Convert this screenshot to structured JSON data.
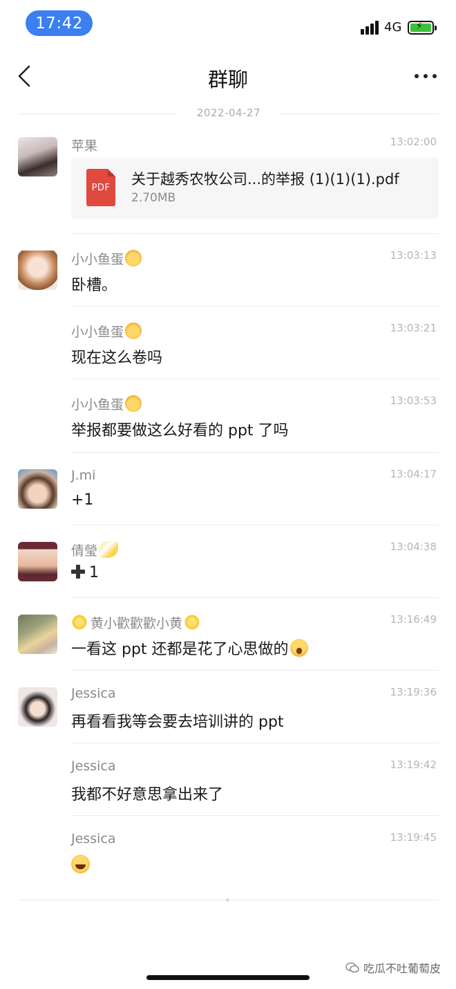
{
  "status_bar": {
    "time": "17:42",
    "network": "4G",
    "battery_charging": true
  },
  "nav": {
    "title": "群聊"
  },
  "date_divider": "2022-04-27",
  "file_message": {
    "sender": "苹果",
    "timestamp": "13:02:00",
    "file_type": "PDF",
    "file_name": "关于越秀农牧公司...的举报 (1)(1)(1).pdf",
    "file_size": "2.70MB"
  },
  "messages": [
    {
      "sender": "小小鱼蛋",
      "sender_emoji": "girl-emoji",
      "timestamp": "13:03:13",
      "text": "卧槽。"
    },
    {
      "sender": "小小鱼蛋",
      "sender_emoji": "girl-emoji",
      "timestamp": "13:03:21",
      "text": "现在这么卷吗"
    },
    {
      "sender": "小小鱼蛋",
      "sender_emoji": "girl-emoji",
      "timestamp": "13:03:53",
      "text": "举报都要做这么好看的 ppt 了吗"
    },
    {
      "sender": "J.mi",
      "timestamp": "13:04:17",
      "text": "+1"
    },
    {
      "sender": "倩瑩",
      "sender_emoji": "comet-emoji",
      "timestamp": "13:04:38",
      "text": "1",
      "prefix_icon": "heavy-plus-icon"
    },
    {
      "sender": "黄小歡歡歡小黄",
      "sender_emoji": "star-emoji",
      "timestamp": "13:16:49",
      "text": "一看这 ppt 还都是花了心思做的",
      "suffix_emoji": "shocked-face-emoji"
    },
    {
      "sender": "Jessica",
      "timestamp": "13:19:36",
      "text": "再看看我等会要去培训讲的 ppt"
    },
    {
      "sender": "Jessica",
      "timestamp": "13:19:42",
      "text": "我都不好意思拿出来了"
    },
    {
      "sender": "Jessica",
      "timestamp": "13:19:45",
      "text": "",
      "suffix_emoji": "tears-of-joy-emoji"
    }
  ],
  "watermark": "吃瓜不吐葡萄皮",
  "colors": {
    "time_pill": "#3b7ff0",
    "pdf_icon": "#e0493e",
    "battery_fill": "#3cc13b"
  }
}
